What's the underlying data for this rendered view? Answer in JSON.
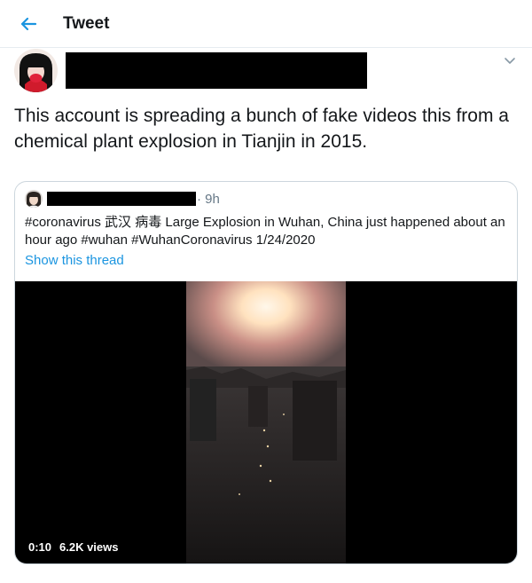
{
  "header": {
    "title": "Tweet"
  },
  "tweet": {
    "text": "This account is spreading a bunch of fake videos this from a chemical plant explosion in Tianjin in 2015."
  },
  "quoted_tweet": {
    "time": "· 9h",
    "text": "#coronavirus 武汉 病毒 Large Explosion in Wuhan, China just happened about an hour ago #wuhan #WuhanCoronavirus 1/24/2020",
    "thread_link": "Show this thread",
    "video": {
      "duration": "0:10",
      "views": "6.2K views"
    }
  },
  "colors": {
    "accent": "#1b95e0",
    "border": "#ccd6dd",
    "muted": "#657786"
  },
  "icons": {
    "back": "back-arrow-icon",
    "more": "chevron-down-icon"
  }
}
